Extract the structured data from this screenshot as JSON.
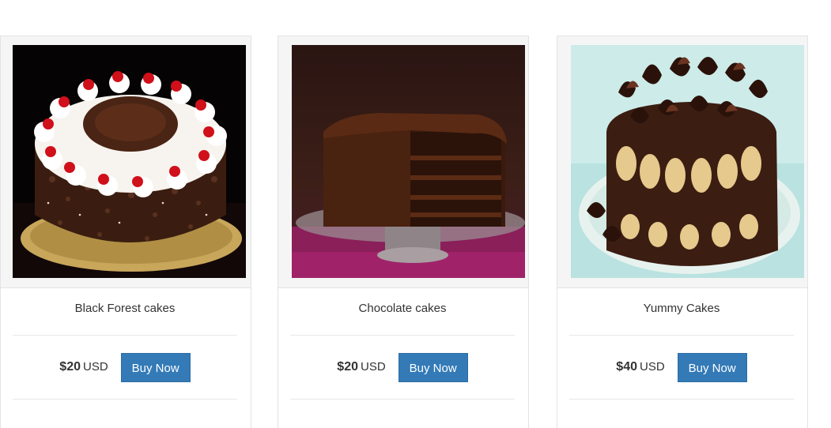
{
  "products": [
    {
      "title": "Black Forest cakes",
      "price": "$20",
      "currency": "USD",
      "button_label": "Buy Now",
      "image": "black-forest-cake"
    },
    {
      "title": "Chocolate cakes",
      "price": "$20",
      "currency": "USD",
      "button_label": "Buy Now",
      "image": "chocolate-layer-cake"
    },
    {
      "title": "Yummy Cakes",
      "price": "$40",
      "currency": "USD",
      "button_label": "Buy Now",
      "image": "chocolate-curl-cake"
    }
  ],
  "colors": {
    "button_bg": "#337ab7",
    "button_border": "#2e6da4",
    "card_border": "#e3e3e3",
    "media_bg": "#f5f5f5"
  }
}
